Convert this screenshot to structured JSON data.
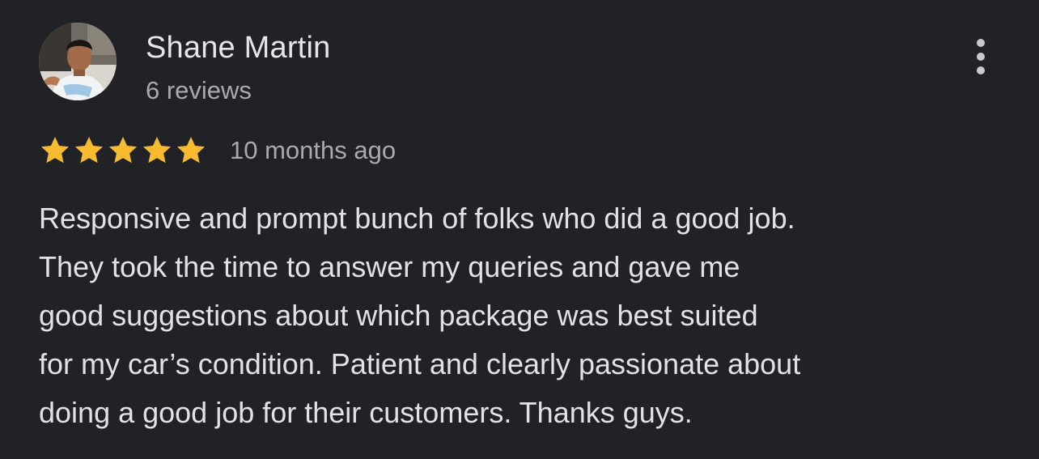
{
  "review": {
    "author": {
      "name": "Shane Martin",
      "review_count": "6 reviews",
      "avatar_icon": "profile-photo"
    },
    "rating": {
      "stars": 5,
      "max_stars": 5,
      "star_color": "#f6bb2f"
    },
    "date": "10 months ago",
    "text_lines": [
      "Responsive and prompt bunch of folks who did a good job.",
      "They took the time to answer my queries and gave me",
      "good suggestions about which package was best suited",
      "for my car’s condition. Patient and clearly passionate about",
      "doing a good job for their customers. Thanks guys."
    ],
    "menu_icon": "more-vertical-icon"
  },
  "colors": {
    "background": "#212226",
    "primary_text": "#e6e6e8",
    "secondary_text": "#a9aaad"
  }
}
